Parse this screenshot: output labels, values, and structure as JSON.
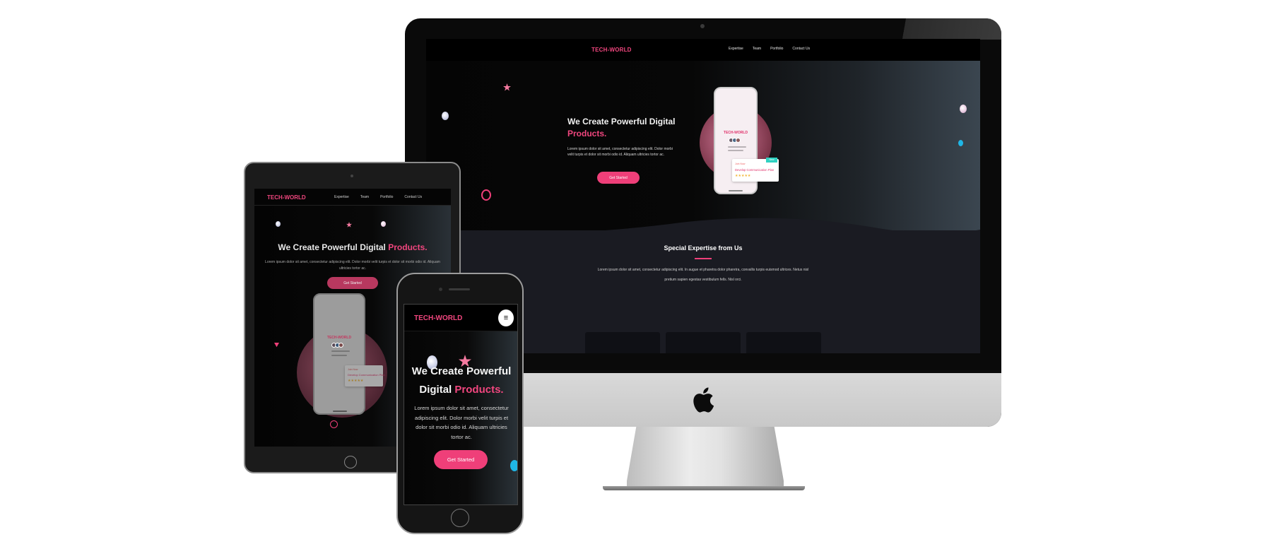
{
  "brand": {
    "logo": "TECH-WORLD",
    "accent": "#ef3f79",
    "teal": "#2fd1c1",
    "cyan": "#1fb6e6"
  },
  "nav": {
    "links": [
      "Expertise",
      "Team",
      "Portfolio",
      "Contact Us"
    ],
    "menu_icon": "hamburger-icon"
  },
  "hero": {
    "title_main": "We Create Powerful Digital",
    "title_accent": "Products.",
    "phone_title_line1": "We Create Powerful",
    "phone_title_line2": "Digital",
    "description": "Lorem ipsum dolor sit amet, consectetur adipiscing elit. Dolor morbi velit turpis et dolor sit morbi odio id. Aliquam ultricies tortor ac.",
    "cta": "Get Started"
  },
  "expertise": {
    "title": "Special Expertise from Us",
    "description": "Lorem ipsum dolor sit amet, consectetur adipiscing elit. In augue et pharetra dolor pharetra, convallis turpis euismod ultrices. Netus nisl pretium sapien egestas vestibulum fells. Nisl orci."
  },
  "mockup": {
    "logo": "TECH-WORLD",
    "card_small": "Join Now",
    "card_title": "Develop Communication Plan",
    "card_tag": "New",
    "stars": "★★★★★"
  },
  "hardware": {
    "brand_icon": "apple-logo-icon"
  }
}
